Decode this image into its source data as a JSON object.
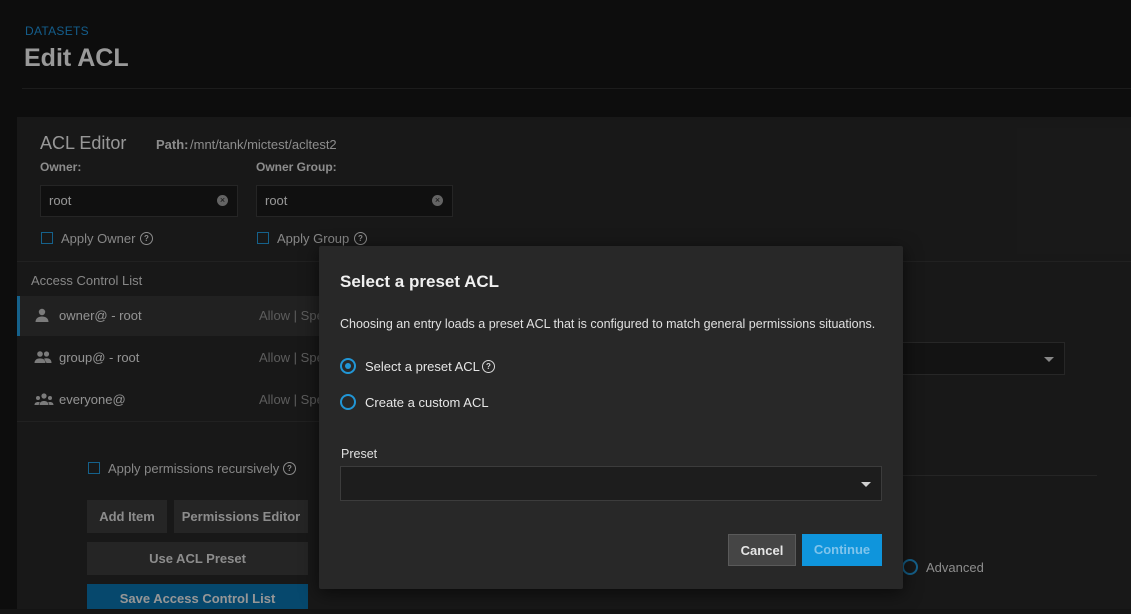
{
  "header": {
    "breadcrumb": "DATASETS",
    "title": "Edit ACL"
  },
  "editor": {
    "title": "ACL Editor",
    "path_label": "Path:",
    "path_value": "/mnt/tank/mictest/acltest2",
    "owner_label": "Owner:",
    "owner_value": "root",
    "owner_group_label": "Owner Group:",
    "owner_group_value": "root",
    "apply_owner_label": "Apply Owner",
    "apply_group_label": "Apply Group"
  },
  "acl": {
    "header": "Access Control List",
    "items": [
      {
        "name": "owner@ - root",
        "perm": "Allow | Spe",
        "icon": "person-icon"
      },
      {
        "name": "group@ - root",
        "perm": "Allow | Spe",
        "icon": "group-icon"
      },
      {
        "name": "everyone@",
        "perm": "Allow | Spe",
        "icon": "everyone-icon"
      }
    ],
    "apply_recursive_label": "Apply permissions recursively",
    "add_item_label": "Add Item",
    "permissions_editor_label": "Permissions Editor",
    "use_preset_label": "Use ACL Preset",
    "save_label": "Save Access Control List"
  },
  "right_panel": {
    "advanced_label": "Advanced"
  },
  "modal": {
    "title": "Select a preset ACL",
    "description": "Choosing an entry loads a preset ACL that is configured to match general permissions situations.",
    "option_preset": "Select a preset ACL",
    "option_custom": "Create a custom ACL",
    "selected_option": "Select a preset ACL",
    "preset_label": "Preset",
    "preset_value": "",
    "cancel_label": "Cancel",
    "continue_label": "Continue"
  },
  "colors": {
    "accent": "#2196d6",
    "primary_button": "#0f95dc"
  }
}
